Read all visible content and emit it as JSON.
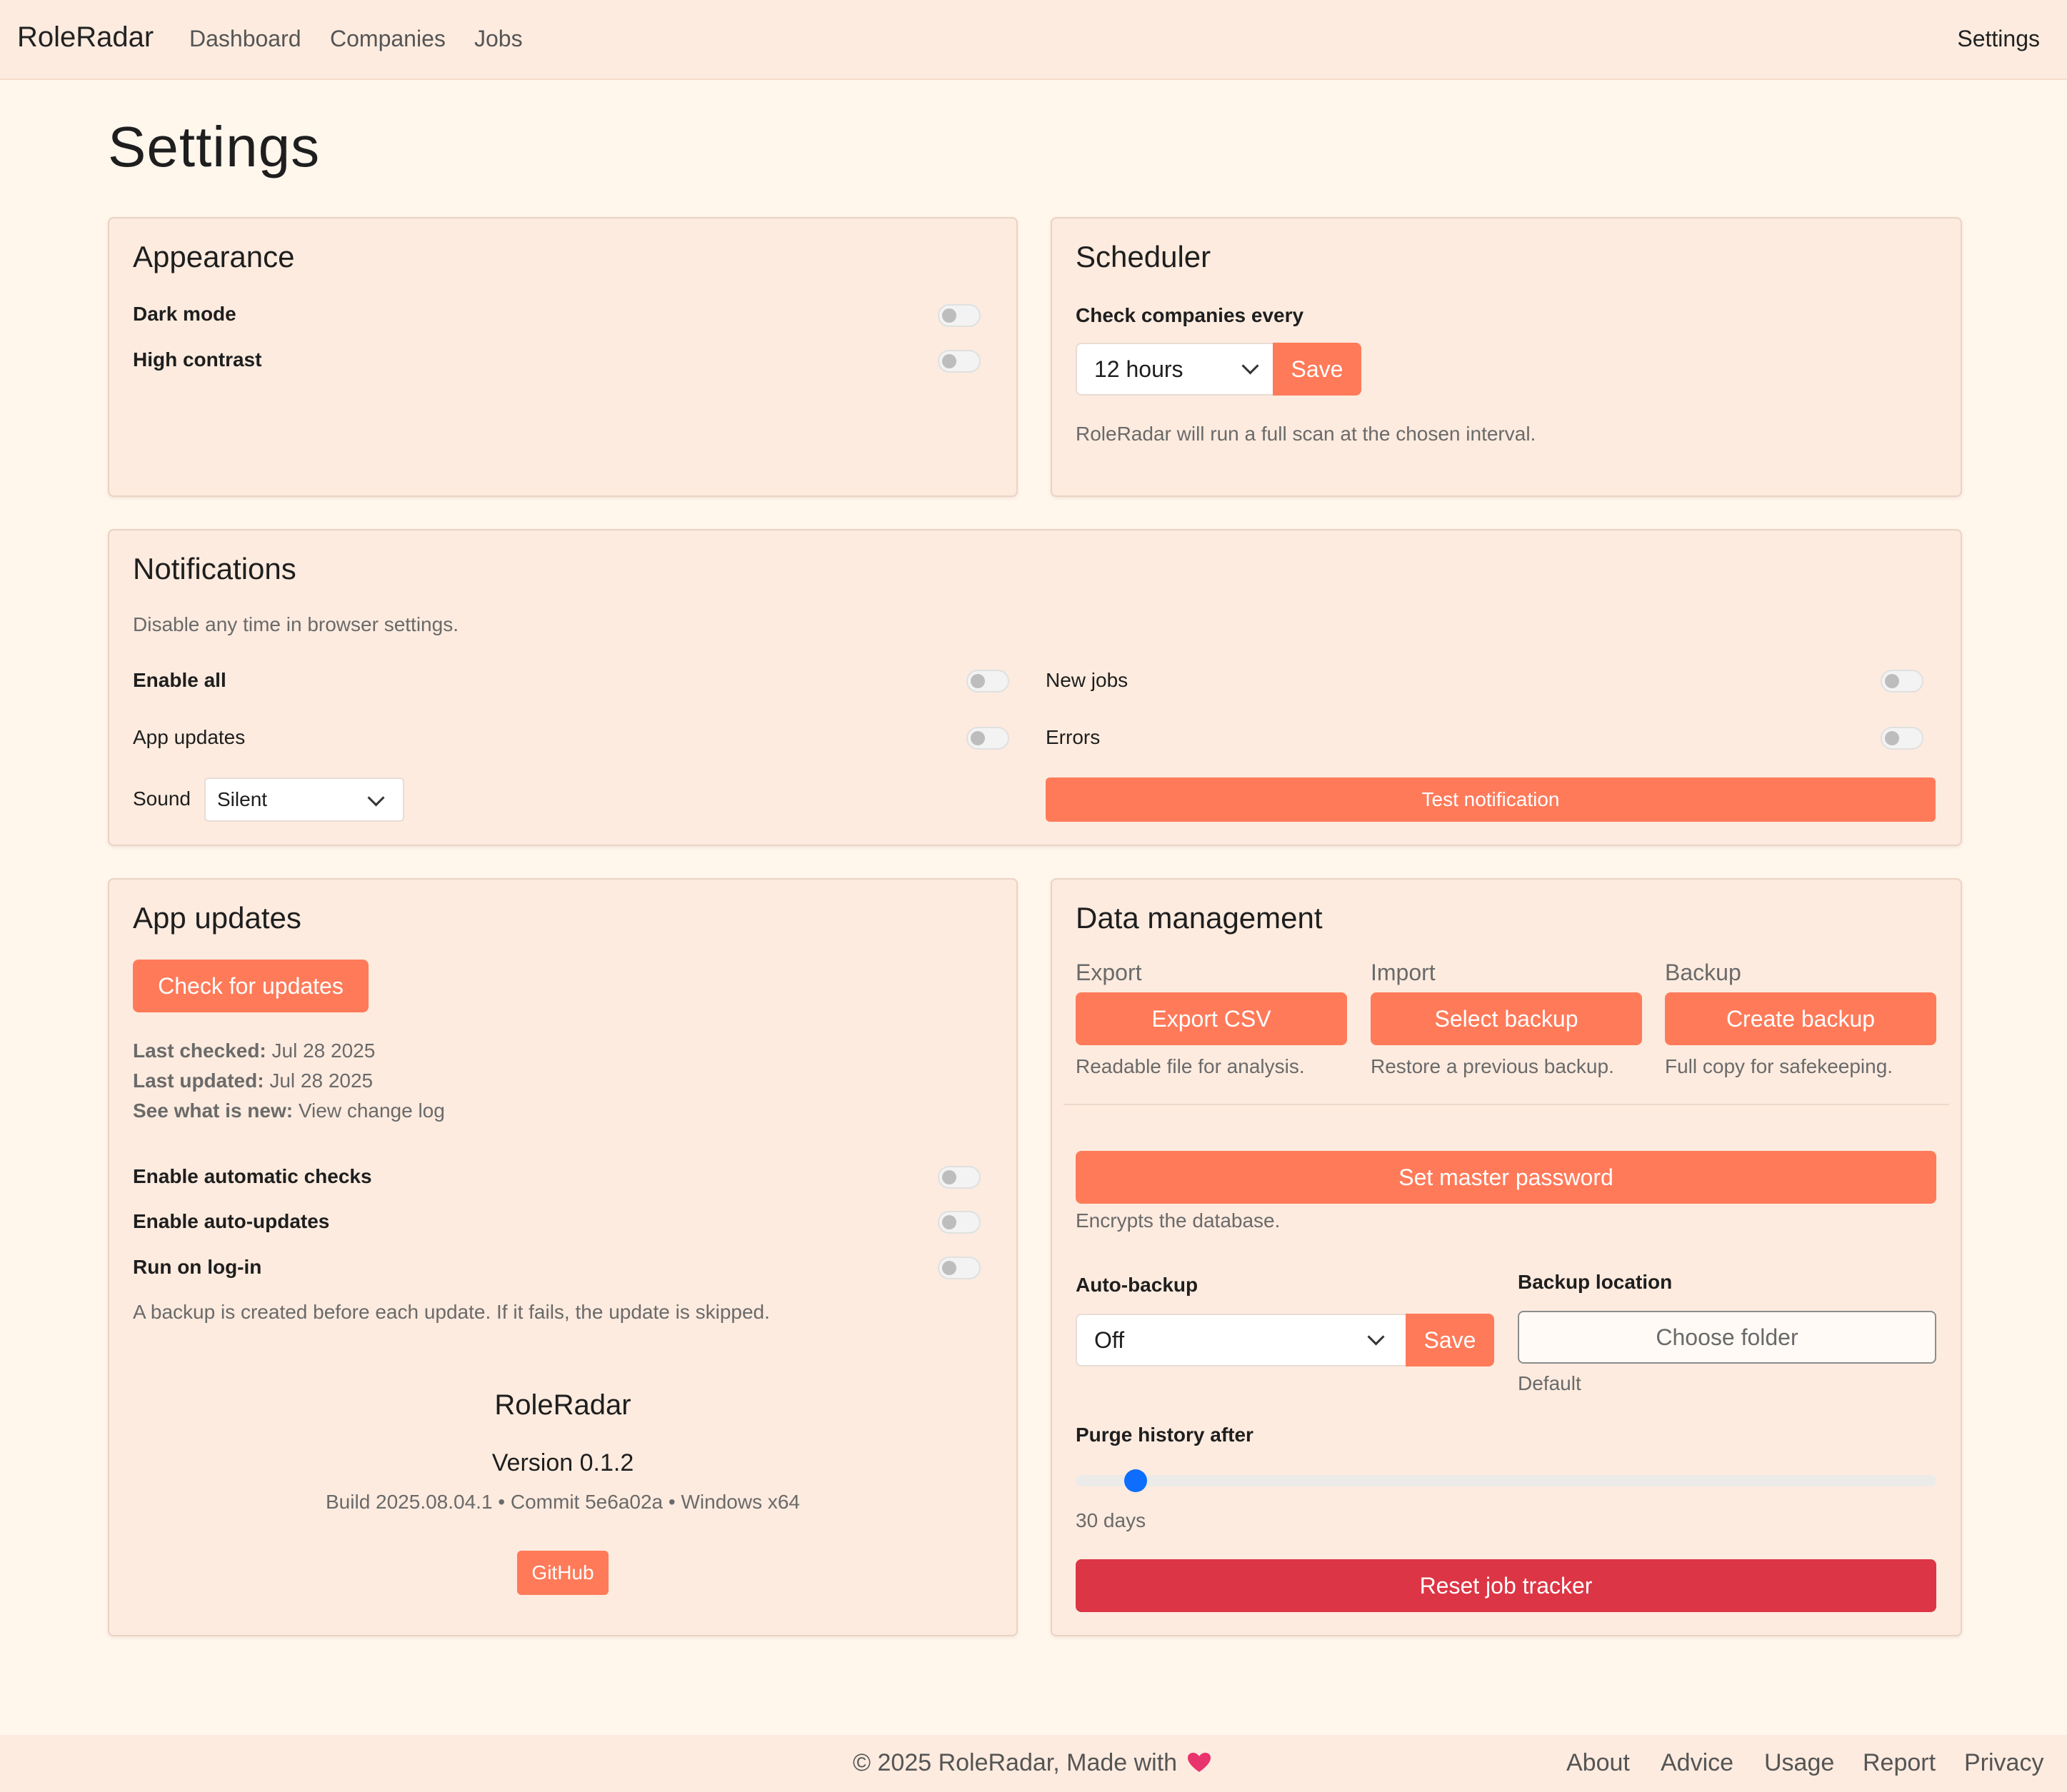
{
  "nav": {
    "brand": "RoleRadar",
    "links": [
      "Dashboard",
      "Companies",
      "Jobs"
    ],
    "settings": "Settings"
  },
  "page": {
    "title": "Settings"
  },
  "appearance": {
    "title": "Appearance",
    "dark_mode": "Dark mode",
    "high_contrast": "High contrast"
  },
  "scheduler": {
    "title": "Scheduler",
    "label": "Check companies every",
    "interval": "12 hours",
    "save": "Save",
    "help": "RoleRadar will run a full scan at the chosen interval."
  },
  "notifications": {
    "title": "Notifications",
    "help": "Disable any time in browser settings.",
    "enable_all": "Enable all",
    "new_jobs": "New jobs",
    "app_updates": "App updates",
    "errors": "Errors",
    "sound_label": "Sound",
    "sound_value": "Silent",
    "test_button": "Test notification"
  },
  "app_updates": {
    "title": "App updates",
    "check_button": "Check for updates",
    "last_checked_label": "Last checked:",
    "last_checked_value": "Jul 28 2025",
    "last_updated_label": "Last updated:",
    "last_updated_value": "Jul 28 2025",
    "whats_new_label": "See what is new:",
    "whats_new_link": "View change log",
    "auto_checks": "Enable automatic checks",
    "auto_updates": "Enable auto-updates",
    "run_on_login": "Run on log-in",
    "backup_note": "A backup is created before each update. If it fails, the update is skipped.",
    "app_name": "RoleRadar",
    "version": "Version 0.1.2",
    "build_info": "Build 2025.08.04.1 • Commit 5e6a02a • Windows x64",
    "github": "GitHub"
  },
  "data_management": {
    "title": "Data management",
    "export_label": "Export",
    "export_button": "Export CSV",
    "export_help": "Readable file for analysis.",
    "import_label": "Import",
    "import_button": "Select backup",
    "import_help": "Restore a previous backup.",
    "backup_label": "Backup",
    "backup_button": "Create backup",
    "backup_help": "Full copy for safekeeping.",
    "master_password_button": "Set master password",
    "master_password_help": "Encrypts the database.",
    "auto_backup_label": "Auto-backup",
    "auto_backup_value": "Off",
    "auto_backup_save": "Save",
    "backup_location_label": "Backup location",
    "choose_folder": "Choose folder",
    "location_value": "Default",
    "purge_label": "Purge history after",
    "purge_value": "30 days",
    "purge_slider_fraction": 0.07,
    "reset_button": "Reset job tracker"
  },
  "footer": {
    "copyright": "© 2025 RoleRadar, Made with",
    "links": [
      "About",
      "Advice",
      "Usage",
      "Report",
      "Privacy"
    ]
  },
  "colors": {
    "accent": "#ff7a59",
    "danger": "#dc3545",
    "slider": "#0d6efd",
    "heart": "#e8336d"
  }
}
